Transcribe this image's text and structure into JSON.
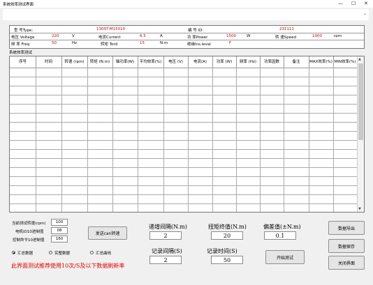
{
  "window": {
    "title": "系统效率测试界面"
  },
  "info": {
    "model_label": "型 号Type:",
    "model_value": "130ST-M15010",
    "id_label": "编 号 ID:",
    "id_value": "231111",
    "voltage_label": "电压 Voltage",
    "voltage_value": "220",
    "voltage_unit": "V",
    "current_label": "电流Current",
    "current_value": "6.5",
    "current_unit": "A",
    "power_label": "功 率Power",
    "power_value": "1500",
    "power_unit": "W",
    "speed_label": "转 速Speed",
    "speed_value": "1000",
    "speed_unit": "rpm",
    "freq_label": "频 率 Freq",
    "freq_value": "50",
    "freq_unit": "Hz",
    "torque_label": "转矩 Tord",
    "torque_value": "15",
    "torque_unit": "N.m",
    "ins_label": "绝缘Ins.leval",
    "ins_value": "F"
  },
  "table": {
    "title": "系统效率测试",
    "columns": [
      "序号",
      "时间",
      "转速 (rpm)",
      "转矩 (N.m)",
      "轴功率(W)",
      "平均效率(%)",
      "电压 (V)",
      "电流(A)",
      "功率 (W)",
      "频率 (Hz)",
      "功率因数",
      "备注",
      "MAX效率(%)",
      "MIN效率(%)"
    ]
  },
  "controls": {
    "speed_label": "当前测试转速(rpm)",
    "speed_value": "100",
    "motor_id_label": "电机ID10进制值",
    "motor_id_value": "08",
    "ctrl_cmd_label": "控制命令10进制值",
    "ctrl_cmd_value": "160",
    "send_button": "发送can转速",
    "step_label": "递增间隔(N.m)",
    "step_value": "2",
    "torque_end_label": "扭矩终值(N.m)",
    "torque_end_value": "20",
    "offset_label": "偏差值(±N.m)",
    "offset_value": "0.1",
    "record_interval_label": "记录间隔(S)",
    "record_interval_value": "2",
    "record_time_label": "记录时间(S)",
    "record_time_value": "50",
    "start_button": "开始测试",
    "export_button": "数据导出",
    "save_button": "数据保存",
    "close_button": "关闭界面",
    "radio_summary": "汇总数据",
    "radio_realtime": "实整数据",
    "radio_curve": "汇总曲线",
    "radio_selected": "汇总数据",
    "notice": "此界面测试推荐使用10次/S及以下数据刷新率"
  }
}
